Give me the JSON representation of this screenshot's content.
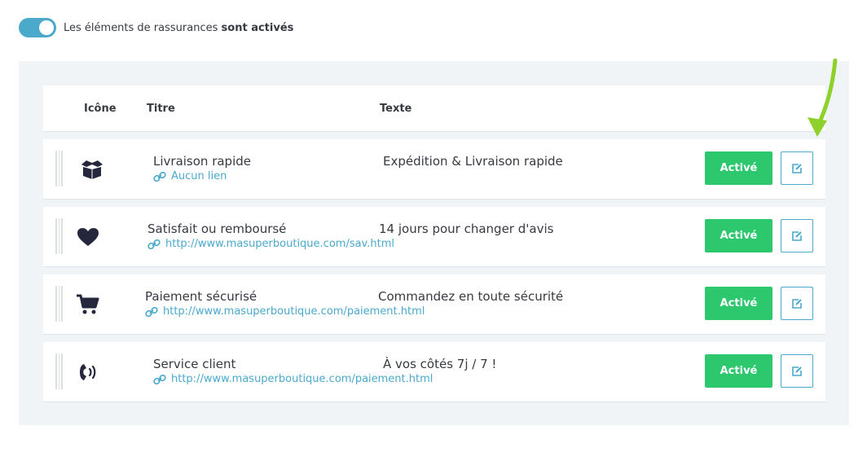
{
  "toggle": {
    "label_prefix": "Les éléments de rassurances",
    "label_status": "sont activés",
    "state": "on",
    "color": "#4ba9cc"
  },
  "table": {
    "headers": {
      "icon": "Icône",
      "title": "Titre",
      "text": "Texte"
    },
    "rows": [
      {
        "icon": "box-icon",
        "title": "Livraison rapide",
        "link": "Aucun lien",
        "text": "Expédition & Livraison rapide",
        "status": "Activé",
        "edit": "edit-icon"
      },
      {
        "icon": "heart-icon",
        "title": "Satisfait ou remboursé",
        "link": "http://www.masuperboutique.com/sav.html",
        "text": "14 jours pour changer d'avis",
        "status": "Activé",
        "edit": "edit-icon"
      },
      {
        "icon": "cart-icon",
        "title": "Paiement sécurisé",
        "link": "http://www.masuperboutique.com/paiement.html",
        "text": "Commandez en toute sécurité",
        "status": "Activé",
        "edit": "edit-icon"
      },
      {
        "icon": "phone-icon",
        "title": "Service client",
        "link": "http://www.masuperboutique.com/paiement.html",
        "text": "À vos côtés 7j / 7 !",
        "status": "Activé",
        "edit": "edit-icon"
      }
    ]
  },
  "colors": {
    "active_button": "#2dc86e",
    "accent": "#4ba9cc",
    "annotation_arrow": "#8fd12b",
    "panel_bg": "#f1f4f7"
  }
}
